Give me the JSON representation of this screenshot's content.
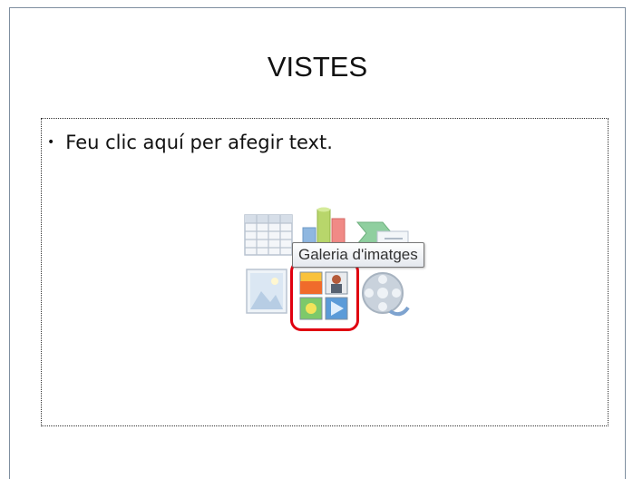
{
  "slide": {
    "title": "VISTES",
    "content_placeholder": {
      "bullet": "•",
      "text": "Feu clic aquí per afegir text."
    },
    "insert_icons": [
      {
        "name": "table-icon"
      },
      {
        "name": "chart-icon"
      },
      {
        "name": "smartart-icon"
      },
      {
        "name": "picture-icon"
      },
      {
        "name": "clip-art-gallery-icon"
      },
      {
        "name": "media-clip-icon"
      }
    ],
    "tooltip": "Galeria d'imatges",
    "highlight_color": "#e00010"
  }
}
